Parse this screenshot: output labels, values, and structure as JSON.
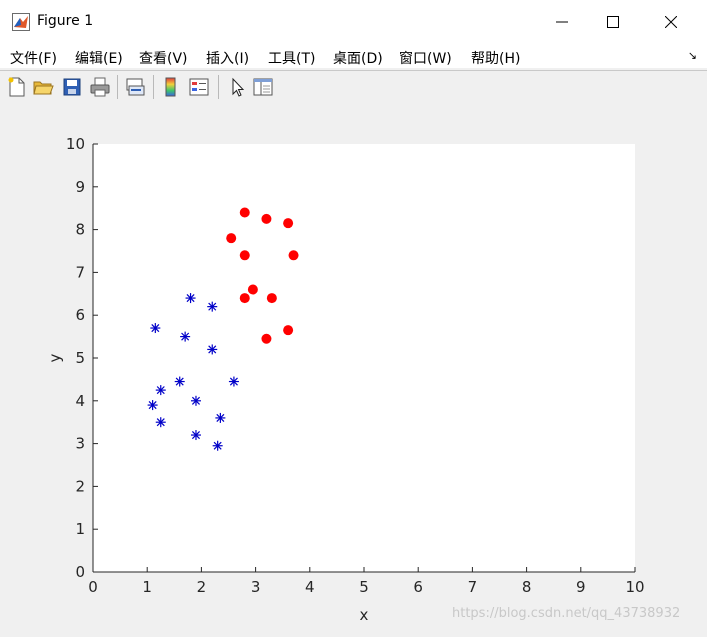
{
  "window": {
    "title": "Figure 1"
  },
  "menu": {
    "items": [
      "文件(F)",
      "编辑(E)",
      "查看(V)",
      "插入(I)",
      "工具(T)",
      "桌面(D)",
      "窗口(W)",
      "帮助(H)"
    ]
  },
  "toolbar": {
    "icons": [
      "new-figure-icon",
      "open-file-icon",
      "save-icon",
      "print-icon",
      "link-plot-icon",
      "colorbar-icon",
      "legend-icon",
      "select-arrow-icon",
      "property-inspector-icon"
    ]
  },
  "chart_data": {
    "type": "scatter",
    "xlabel": "x",
    "ylabel": "y",
    "xlim": [
      0,
      10
    ],
    "ylim": [
      0,
      10
    ],
    "xticks": [
      "0",
      "1",
      "2",
      "3",
      "4",
      "5",
      "6",
      "7",
      "8",
      "9",
      "10"
    ],
    "yticks": [
      "0",
      "1",
      "2",
      "3",
      "4",
      "5",
      "6",
      "7",
      "8",
      "9",
      "10"
    ],
    "grid": false,
    "series": [
      {
        "marker": "asterisk",
        "color": "#0000c8",
        "points": [
          [
            1.8,
            6.4
          ],
          [
            2.2,
            6.2
          ],
          [
            1.15,
            5.7
          ],
          [
            1.7,
            5.5
          ],
          [
            2.2,
            5.2
          ],
          [
            1.6,
            4.45
          ],
          [
            2.6,
            4.45
          ],
          [
            1.25,
            4.25
          ],
          [
            1.1,
            3.9
          ],
          [
            1.9,
            4.0
          ],
          [
            2.35,
            3.6
          ],
          [
            1.25,
            3.5
          ],
          [
            1.9,
            3.2
          ],
          [
            2.3,
            2.95
          ]
        ]
      },
      {
        "marker": "filled-circle",
        "color": "#ff0000",
        "points": [
          [
            2.8,
            8.4
          ],
          [
            3.2,
            8.25
          ],
          [
            3.6,
            8.15
          ],
          [
            2.55,
            7.8
          ],
          [
            2.8,
            7.4
          ],
          [
            3.7,
            7.4
          ],
          [
            2.95,
            6.6
          ],
          [
            2.8,
            6.4
          ],
          [
            3.3,
            6.4
          ],
          [
            3.6,
            5.65
          ],
          [
            3.2,
            5.45
          ]
        ]
      }
    ]
  },
  "watermark": "https://blog.csdn.net/qq_43738932"
}
